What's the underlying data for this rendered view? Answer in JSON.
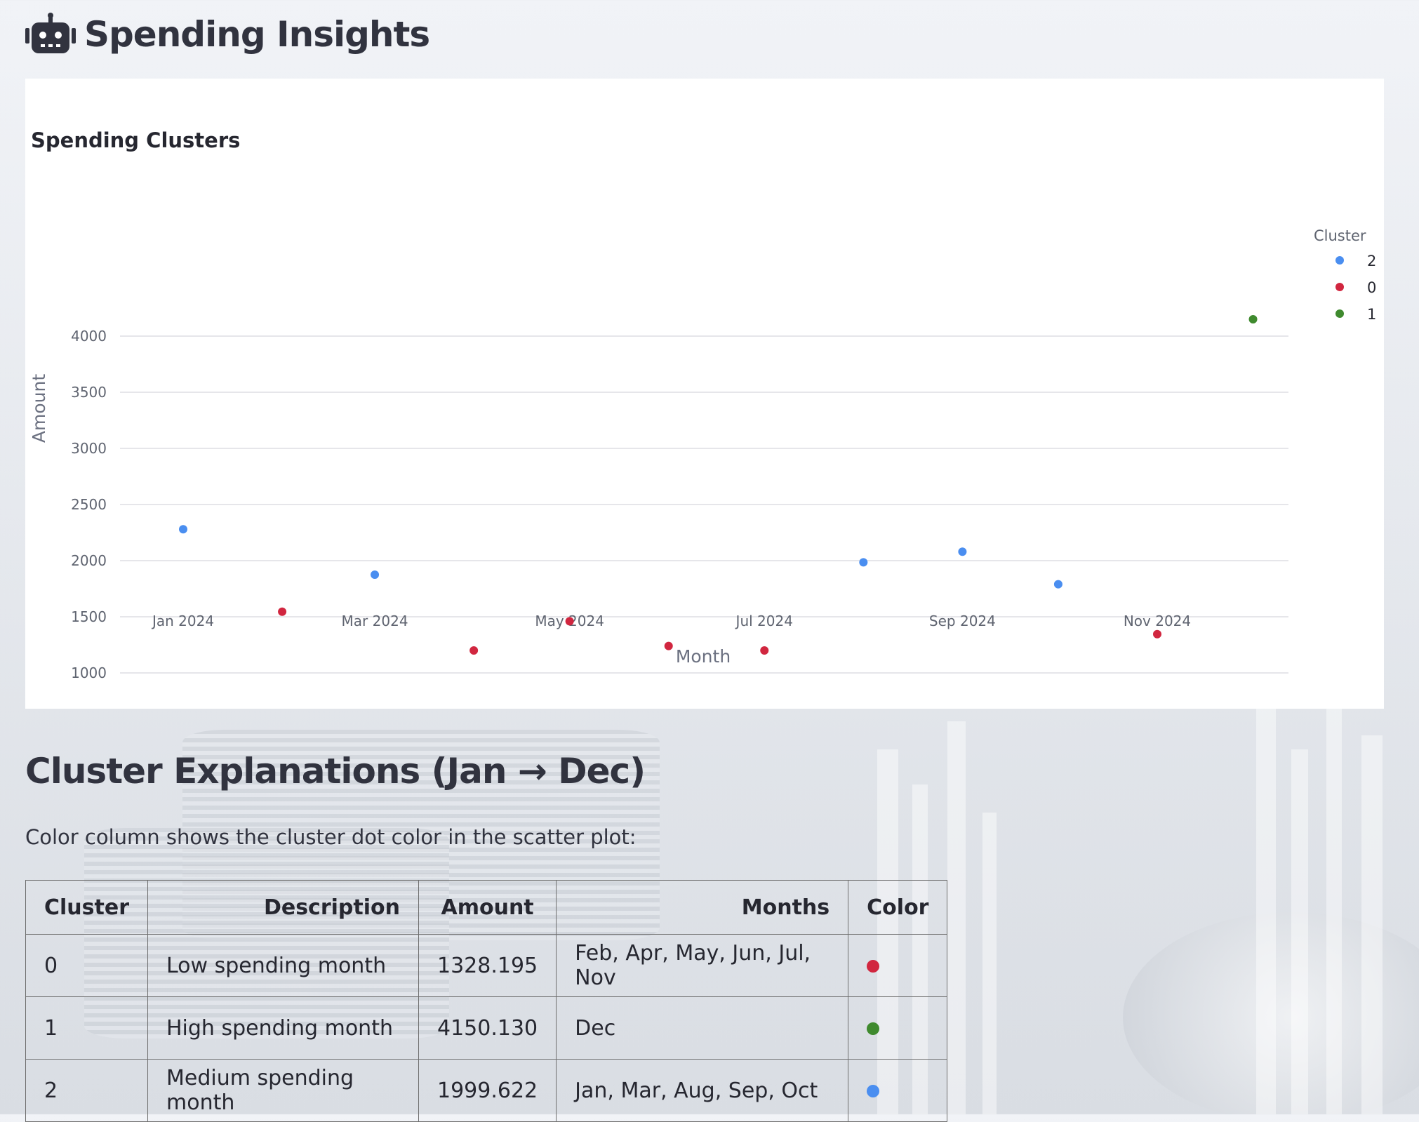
{
  "page": {
    "title": "Spending Insights",
    "title_icon": "robot-icon"
  },
  "chart_data": {
    "type": "scatter",
    "title": "Spending Clusters",
    "xlabel": "Month",
    "ylabel": "Amount",
    "x_type": "date",
    "x_ticks": [
      "Jan 2024",
      "Mar 2024",
      "May 2024",
      "Jul 2024",
      "Sep 2024",
      "Nov 2024"
    ],
    "y_ticks": [
      1000,
      1500,
      2000,
      2500,
      3000,
      3500,
      4000
    ],
    "grid": true,
    "legend_title": "Cluster",
    "legend_position": "top-right",
    "series": [
      {
        "name": "2",
        "color": "#4a8ef0",
        "points": [
          {
            "x": "2024-01-01",
            "y": 2280
          },
          {
            "x": "2024-03-01",
            "y": 1875
          },
          {
            "x": "2024-08-01",
            "y": 1985
          },
          {
            "x": "2024-09-01",
            "y": 2080
          },
          {
            "x": "2024-10-01",
            "y": 1790
          }
        ]
      },
      {
        "name": "0",
        "color": "#d1263f",
        "points": [
          {
            "x": "2024-02-01",
            "y": 1545
          },
          {
            "x": "2024-04-01",
            "y": 1200
          },
          {
            "x": "2024-05-01",
            "y": 1460
          },
          {
            "x": "2024-06-01",
            "y": 1240
          },
          {
            "x": "2024-07-01",
            "y": 1200
          },
          {
            "x": "2024-11-01",
            "y": 1345
          }
        ]
      },
      {
        "name": "1",
        "color": "#3f8a2e",
        "points": [
          {
            "x": "2024-12-01",
            "y": 4150
          }
        ]
      }
    ]
  },
  "explanations": {
    "title": "Cluster Explanations (Jan → Dec)",
    "caption": "Color column shows the cluster dot color in the scatter plot:",
    "columns": [
      "Cluster",
      "Description",
      "Amount",
      "Months",
      "Color"
    ],
    "rows": [
      {
        "cluster": "0",
        "description": "Low spending month",
        "amount": "1328.195",
        "months": "Feb, Apr, May, Jun, Jul, Nov",
        "color": "#d1263f"
      },
      {
        "cluster": "1",
        "description": "High spending month",
        "amount": "4150.130",
        "months": "Dec",
        "color": "#3f8a2e"
      },
      {
        "cluster": "2",
        "description": "Medium spending month",
        "amount": "1999.622",
        "months": "Jan, Mar, Aug, Sep, Oct",
        "color": "#4a8ef0"
      }
    ]
  }
}
